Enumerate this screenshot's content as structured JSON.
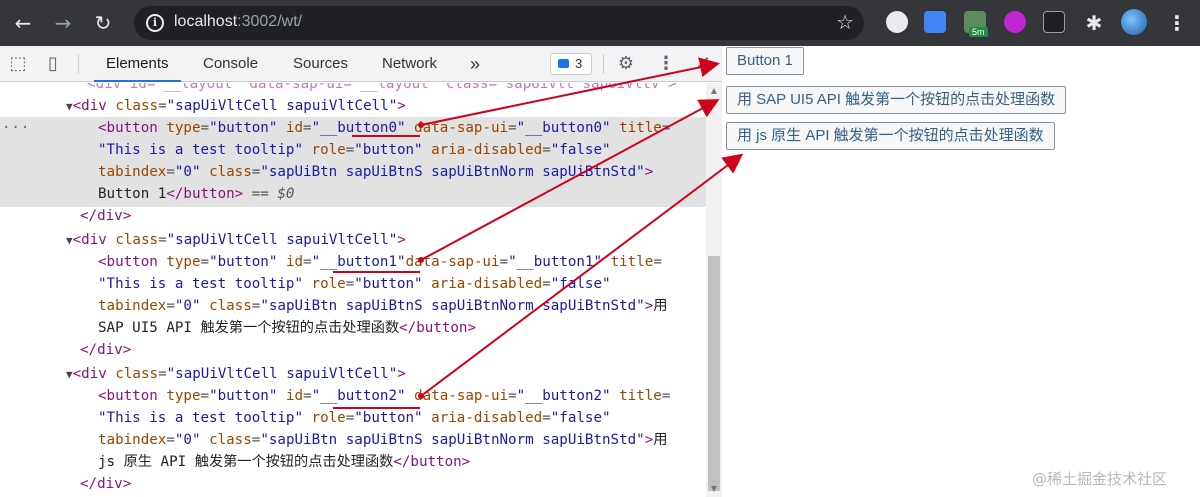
{
  "browser": {
    "url_host": "localhost",
    "url_port_path": ":3002/wt/",
    "extension_badge": "5m"
  },
  "devtools": {
    "tabs": [
      "Elements",
      "Console",
      "Sources",
      "Network"
    ],
    "more_tabs": "»",
    "message_count": "3",
    "lines": {
      "l0": "  <div id=\"__layout\" data-sap-ui=\"__layout\" class=\"sapUiVlt sapUiVltV\">",
      "l1_tag": "<div ",
      "l1_attr": "class",
      "l1_val": "\"sapUiVltCell sapuiVltCell\"",
      "l1_end": ">",
      "l2a": "<button ",
      "l2b": "type",
      "l2c": "\"button\"",
      "l2d": "id",
      "l2e": "\"__button0\"",
      "l2f": "data-sap-ui",
      "l2g": "\"__button0\"",
      "l2h": "title",
      "l3a": "\"This is a test tooltip\"",
      "l3b": "role",
      "l3c": "\"button\"",
      "l3d": "aria-disabled",
      "l3e": "\"false\"",
      "l4a": "tabindex",
      "l4b": "\"0\"",
      "l4c": "class",
      "l4d": "\"sapUiBtn sapUiBtnS sapUiBtnNorm sapUiBtnStd\"",
      "l5a": "Button 1",
      "l5b": "</button>",
      "l5c": " == ",
      "l5d": "$0",
      "close_div": "</div>",
      "b1_text": "用",
      "b1_text2": "SAP UI5 API 触发第一个按钮的点击处理函数",
      "b2_text": "用",
      "b2_text2": "js 原生 API 触发第一个按钮的点击处理函数",
      "button1_id": "\"__button1\"",
      "button2_id": "\"__button2\""
    }
  },
  "page": {
    "button1": "Button 1",
    "button2": "用 SAP UI5 API 触发第一个按钮的点击处理函数",
    "button3": "用 js 原生 API 触发第一个按钮的点击处理函数"
  },
  "watermark": "@稀土掘金技术社区",
  "colors": {
    "annotation_arrow": "#d0021b"
  },
  "icons": [
    "back-arrow-icon",
    "forward-arrow-icon",
    "reload-icon",
    "info-icon",
    "star-icon",
    "extensions-icon",
    "inspect-icon",
    "device-icon",
    "settings-icon",
    "kebab-menu-icon",
    "close-icon"
  ]
}
